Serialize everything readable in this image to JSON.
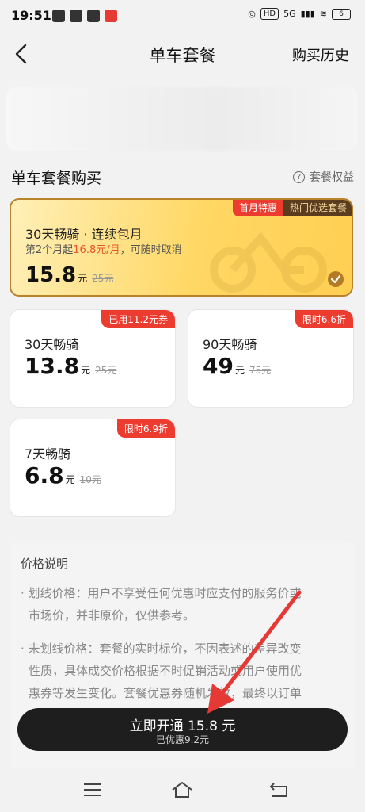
{
  "status": {
    "time": "19:51",
    "hd": "HD",
    "net": "5G",
    "battery": "6"
  },
  "header": {
    "title": "单车套餐",
    "history_label": "购买历史"
  },
  "section": {
    "title": "单车套餐购买",
    "rights_label": "套餐权益"
  },
  "featured": {
    "tag_first": "首月特惠",
    "tag_hot": "热门优选套餐",
    "name": "30天畅骑 · 连续包月",
    "sub_prefix": "第2个月起",
    "sub_highlight": "16.8元/月",
    "sub_suffix": "，可随时取消",
    "price": "15.8",
    "unit": "元",
    "old_price": "25元",
    "selected": true
  },
  "cards": [
    {
      "tag": "已用11.2元券",
      "name": "30天畅骑",
      "price": "13.8",
      "unit": "元",
      "old_price": "25元"
    },
    {
      "tag": "限时6.6折",
      "name": "90天畅骑",
      "price": "49",
      "unit": "元",
      "old_price": "75元"
    },
    {
      "tag": "限时6.9折",
      "name": "7天畅骑",
      "price": "6.8",
      "unit": "元",
      "old_price": "10元"
    }
  ],
  "price_note": {
    "title": "价格说明",
    "item1_line1": "· 划线价格：用户不享受任何优惠时应支付的服务价或",
    "item1_line2": "市场价，并非原价，仅供参考。",
    "item2_line1": "· 未划线价格：套餐的实时标价，不因表述的差异改变",
    "item2_line2": "性质，具体成交价格根据不时促销活动或用户使用优",
    "item2_line3": "惠券等发生变化。套餐优惠券随机发放，最终以订单"
  },
  "buy": {
    "main_label": "立即开通 15.8 元",
    "sub_label": "已优惠9.2元"
  },
  "colors": {
    "accent_red": "#ec3b2f",
    "gold_border": "#b9832a",
    "button_dark": "#1e1e1e",
    "arrow": "#e53935"
  }
}
